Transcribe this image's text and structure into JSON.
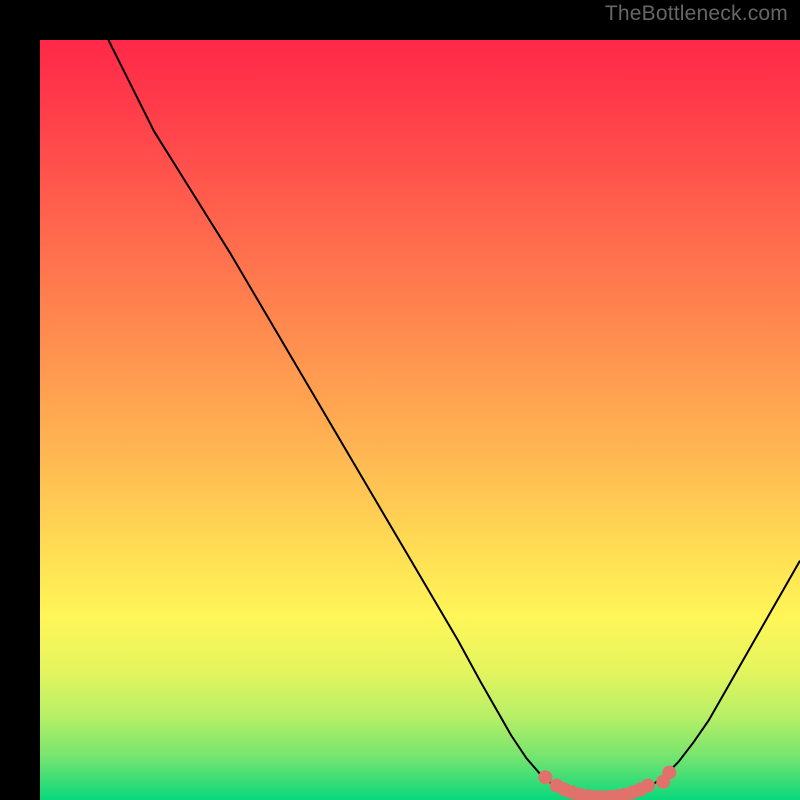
{
  "watermark": "TheBottleneck.com",
  "chart_data": {
    "type": "line",
    "title": "",
    "xlabel": "",
    "ylabel": "",
    "xlim": [
      0,
      100
    ],
    "ylim": [
      0,
      100
    ],
    "grid": false,
    "legend": false,
    "curve_points_xy": [
      [
        9.0,
        100.0
      ],
      [
        12.0,
        94.0
      ],
      [
        15.0,
        88.0
      ],
      [
        20.0,
        80.0
      ],
      [
        25.0,
        72.0
      ],
      [
        30.0,
        63.5
      ],
      [
        35.0,
        55.0
      ],
      [
        40.0,
        46.5
      ],
      [
        45.0,
        38.0
      ],
      [
        50.0,
        29.5
      ],
      [
        55.0,
        21.0
      ],
      [
        58.0,
        15.5
      ],
      [
        60.0,
        12.0
      ],
      [
        62.0,
        8.5
      ],
      [
        64.0,
        5.5
      ],
      [
        66.0,
        3.2
      ],
      [
        68.0,
        1.6
      ],
      [
        70.0,
        0.8
      ],
      [
        72.0,
        0.4
      ],
      [
        74.0,
        0.3
      ],
      [
        76.0,
        0.4
      ],
      [
        78.0,
        0.8
      ],
      [
        80.0,
        1.6
      ],
      [
        82.0,
        3.0
      ],
      [
        84.0,
        5.0
      ],
      [
        86.0,
        7.6
      ],
      [
        88.0,
        10.5
      ],
      [
        90.0,
        14.0
      ],
      [
        92.0,
        17.5
      ],
      [
        94.0,
        21.0
      ],
      [
        96.0,
        24.5
      ],
      [
        98.0,
        28.0
      ],
      [
        100.0,
        31.5
      ]
    ],
    "marker_points_xy": [
      [
        66.5,
        3.0
      ],
      [
        68.0,
        1.9
      ],
      [
        69.0,
        1.4
      ],
      [
        70.0,
        1.0
      ],
      [
        71.0,
        0.7
      ],
      [
        72.0,
        0.5
      ],
      [
        73.0,
        0.4
      ],
      [
        74.0,
        0.35
      ],
      [
        75.0,
        0.4
      ],
      [
        76.0,
        0.5
      ],
      [
        77.0,
        0.7
      ],
      [
        78.0,
        1.0
      ],
      [
        79.0,
        1.4
      ],
      [
        80.0,
        1.9
      ],
      [
        82.0,
        2.4
      ],
      [
        82.8,
        3.6
      ]
    ],
    "marker_color": "#e0716b",
    "line_color": "#000000",
    "background": "spectral-gradient"
  }
}
